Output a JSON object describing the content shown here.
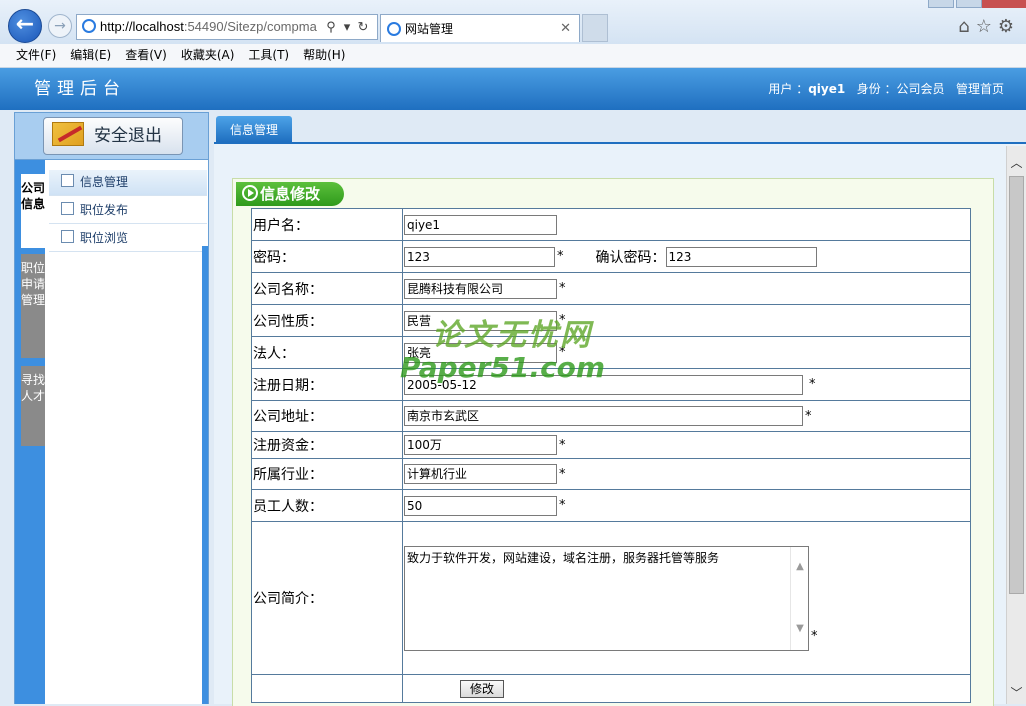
{
  "browser": {
    "url_host": "http://localhost",
    "url_rest": ":54490/Sitezp/compma",
    "tab_title": "网站管理",
    "tab_close": "✕",
    "menu": [
      "文件(F)",
      "编辑(E)",
      "查看(V)",
      "收藏夹(A)",
      "工具(T)",
      "帮助(H)"
    ]
  },
  "header": {
    "title": "管理后台",
    "user_label": "用户 ：",
    "user_name": "qiye1",
    "role_label": "身份 ：",
    "role": "公司会员",
    "home_link": "管理首页"
  },
  "sidebar": {
    "logout_label": "安全退出",
    "tabs": [
      "公司信息",
      "职位申请管理",
      "寻找人才"
    ],
    "items": [
      {
        "label": "信息管理",
        "icon": "checkbox-icon"
      },
      {
        "label": "职位发布",
        "icon": "pages-icon"
      },
      {
        "label": "职位浏览",
        "icon": "book-icon"
      }
    ]
  },
  "main": {
    "tab_label": "信息管理",
    "panel_title": "信息修改"
  },
  "form": {
    "username_label": "用户名：",
    "username": "qiye1",
    "password_label": "密码：",
    "password": "123",
    "confirm_label": "确认密码：",
    "confirm": "123",
    "company_name_label": "公司名称：",
    "company_name": "昆腾科技有限公司",
    "company_type_label": "公司性质：",
    "company_type": "民营",
    "legal_person_label": "法人：",
    "legal_person": "张亮",
    "reg_date_label": "注册日期：",
    "reg_date": "2005-05-12",
    "address_label": "公司地址：",
    "address": "南京市玄武区",
    "capital_label": "注册资金：",
    "capital": "100万",
    "industry_label": "所属行业：",
    "industry": "计算机行业",
    "employees_label": "员工人数：",
    "employees": "50",
    "intro_label": "公司简介：",
    "intro": "致力于软件开发，网站建设，域名注册，服务器托管等服务",
    "required_mark": "*",
    "submit_label": "修改"
  },
  "watermark": {
    "line1": "论文无忧网",
    "line2": "Paper51.com"
  }
}
